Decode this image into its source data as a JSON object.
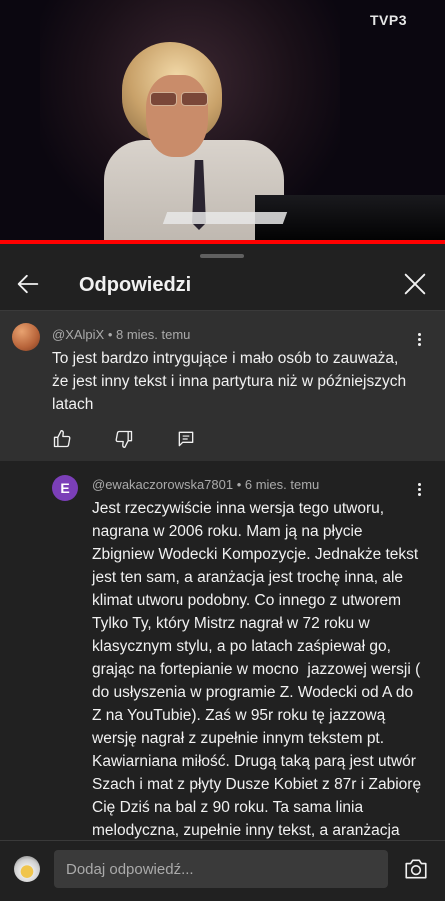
{
  "video": {
    "channel_logo": "TVP3",
    "progress": 1.0
  },
  "panel": {
    "title": "Odpowiedzi"
  },
  "parent_comment": {
    "author": "@XAlpiX",
    "time": "8 mies. temu",
    "meta": "@XAlpiX • 8 mies. temu",
    "text": "To jest bardzo intrygujące i mało osób to zauważa, że jest inny tekst i inna partytura niż w późniejszych latach"
  },
  "reply": {
    "avatar_letter": "E",
    "meta": "@ewakaczorowska7801 • 6 mies. temu",
    "text": "Jest rzeczywiście inna wersja tego utworu, nagrana w 2006 roku. Mam ją na płycie Zbigniew Wodecki Kompozycje. Jednakże tekst jest ten sam, a aranżacja jest trochę inna, ale klimat utworu podobny. Co innego z utworem Tylko Ty, który Mistrz nagrał w 72 roku w klasycznym stylu, a po latach zaśpiewał go, grając na fortepianie w mocno  jazzowej wersji ( do usłyszenia w programie Z. Wodecki od A do Z na YouTubie). Zaś w 95r roku tę jazzową wersję nagrał z zupełnie innym tekstem pt. Kawiarniana miłość. Drugą taką parą jest utwór Szach i mat z płyty Dusze Kobiet z 87r i Zabiorę Cię Dziś na bal z 90 roku. Ta sama linia melodyczna, zupełnie inny tekst, a aranżacja mocno zmieniona. Najciekawsze, że wszystkie"
  },
  "composer": {
    "placeholder": "Dodaj odpowiedź..."
  },
  "colors": {
    "panel_bg": "#212121",
    "parent_bg": "#303030",
    "progress": "#ff0000",
    "reply_avatar": "#7b3fb8"
  },
  "icons": [
    "back-arrow-icon",
    "close-icon",
    "more-vert-icon",
    "thumb-up-icon",
    "thumb-down-icon",
    "reply-icon",
    "camera-icon"
  ]
}
